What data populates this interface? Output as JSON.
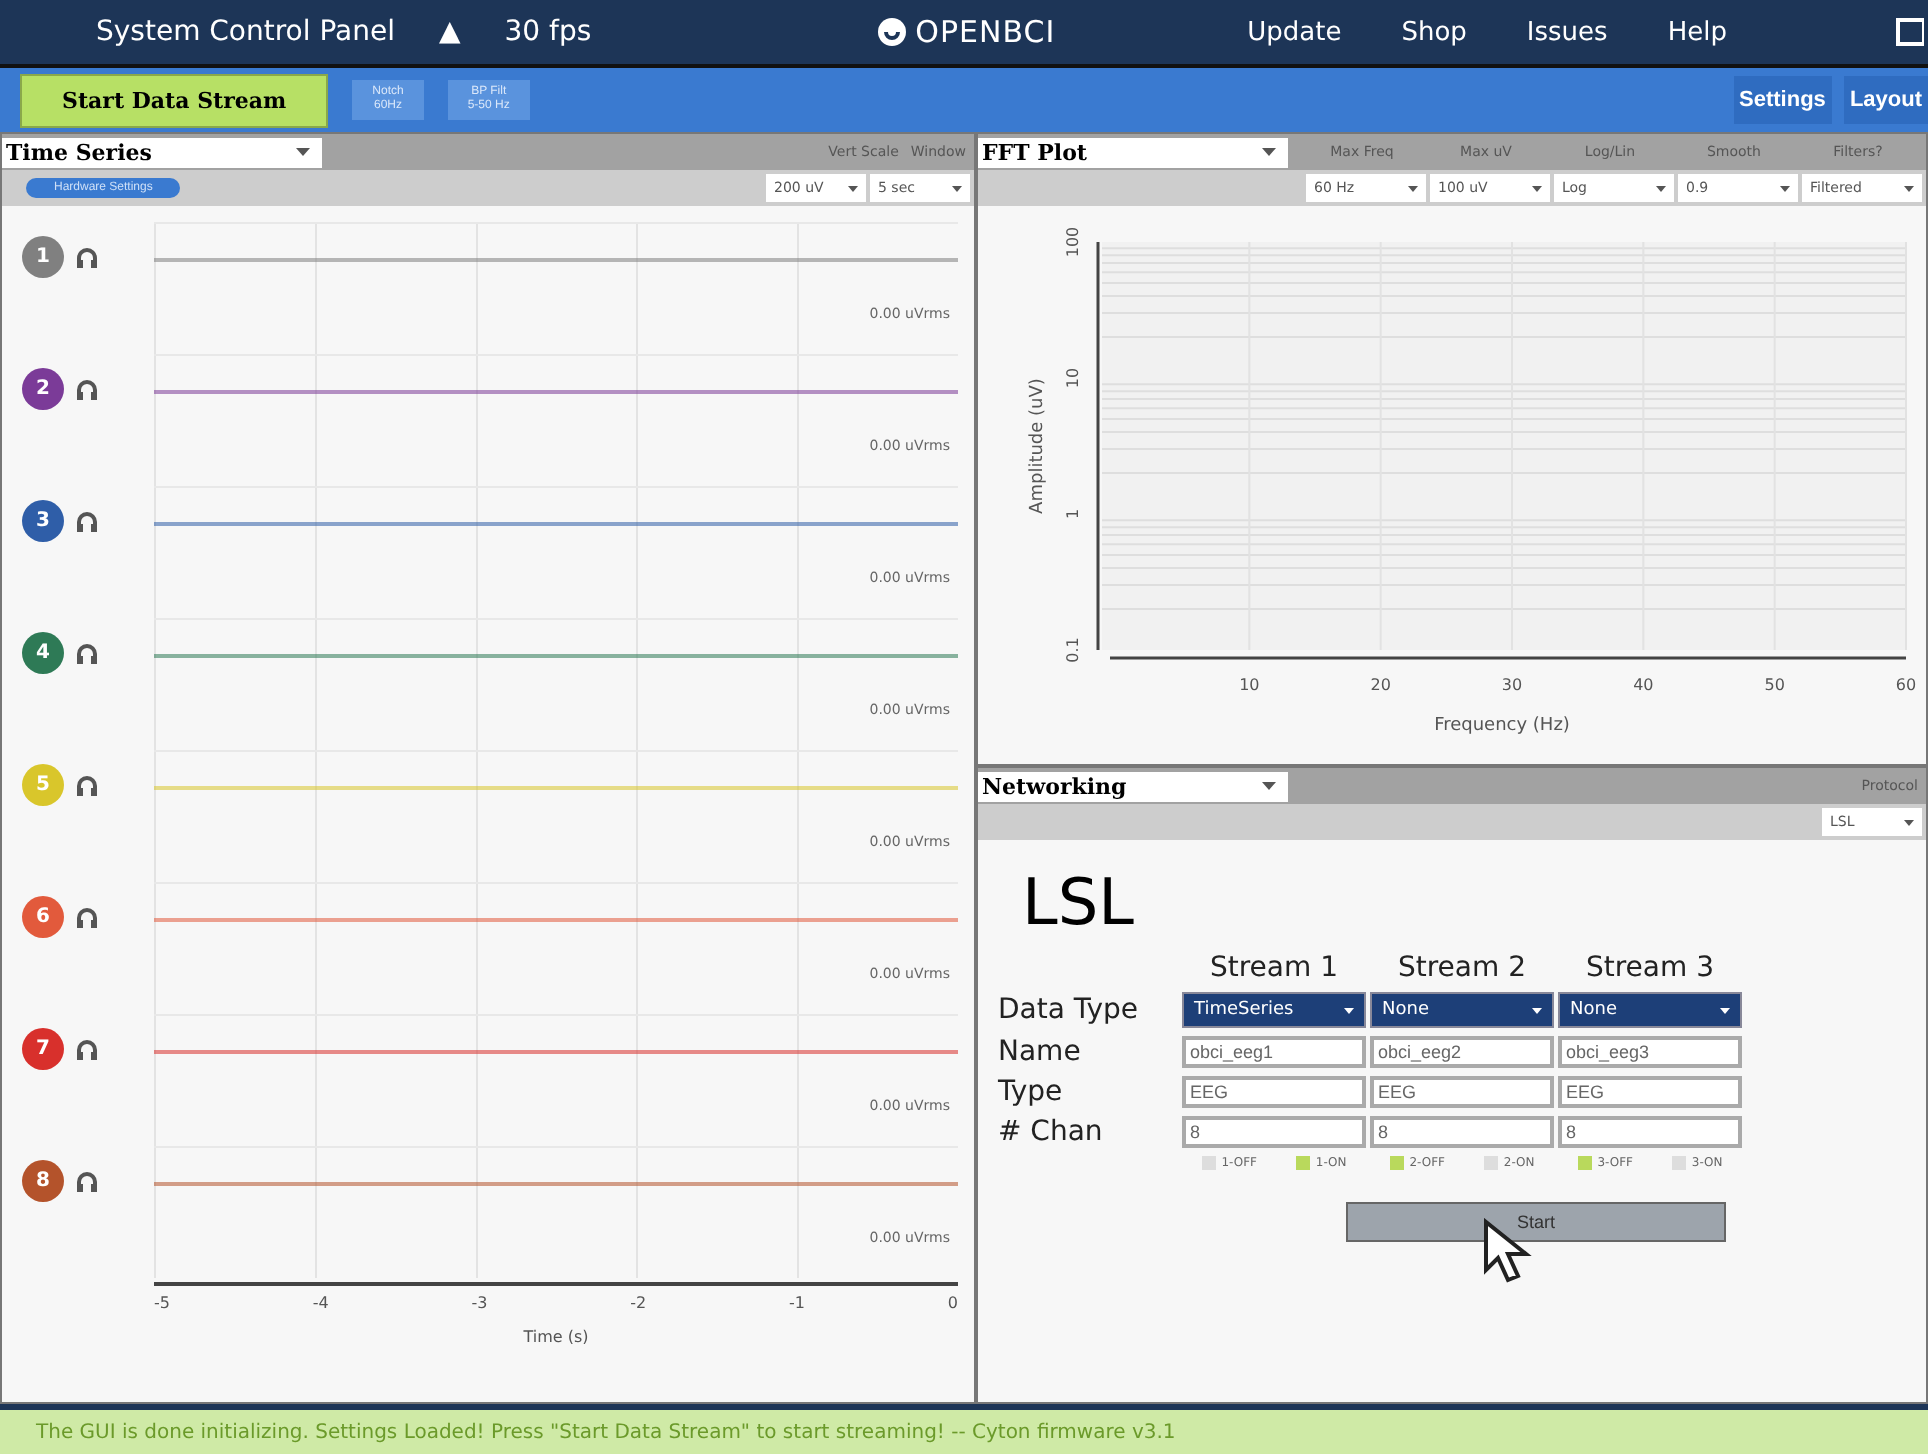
{
  "top_bar": {
    "title": "System Control Panel",
    "collapse_glyph": "▲",
    "fps": "30 fps",
    "logo": "OPENBCI",
    "menu": [
      "Update",
      "Shop",
      "Issues",
      "Help"
    ]
  },
  "toolbar": {
    "start_button": "Start Data Stream",
    "filters": [
      {
        "line1": "Notch",
        "line2": "60Hz"
      },
      {
        "line1": "BP Filt",
        "line2": "5-50 Hz"
      }
    ],
    "right_buttons": [
      "Settings",
      "Layout"
    ]
  },
  "time_series": {
    "widget": "Time Series",
    "hardware_button": "Hardware Settings",
    "controls": [
      {
        "label": "Vert Scale",
        "value": "200 uV"
      },
      {
        "label": "Window",
        "value": "5 sec"
      }
    ],
    "channels": [
      {
        "number": "1",
        "color": "#808080",
        "reading": "0.00 uVrms"
      },
      {
        "number": "2",
        "color": "#7b3b98",
        "reading": "0.00 uVrms"
      },
      {
        "number": "3",
        "color": "#2f5ea8",
        "reading": "0.00 uVrms"
      },
      {
        "number": "4",
        "color": "#2e7a56",
        "reading": "0.00 uVrms"
      },
      {
        "number": "5",
        "color": "#d9c62b",
        "reading": "0.00 uVrms"
      },
      {
        "number": "6",
        "color": "#e25a3c",
        "reading": "0.00 uVrms"
      },
      {
        "number": "7",
        "color": "#d8302c",
        "reading": "0.00 uVrms"
      },
      {
        "number": "8",
        "color": "#b4532b",
        "reading": "0.00 uVrms"
      }
    ],
    "x_ticks": [
      "-5",
      "-4",
      "-3",
      "-2",
      "-1",
      "0"
    ],
    "x_label": "Time (s)"
  },
  "fft": {
    "widget": "FFT Plot",
    "controls": [
      {
        "label": "Max Freq",
        "value": "60 Hz"
      },
      {
        "label": "Max uV",
        "value": "100 uV"
      },
      {
        "label": "Log/Lin",
        "value": "Log"
      },
      {
        "label": "Smooth",
        "value": "0.9"
      },
      {
        "label": "Filters?",
        "value": "Filtered"
      }
    ],
    "y_ticks": [
      "100",
      "10",
      "1",
      "0.1"
    ],
    "x_ticks": [
      "10",
      "20",
      "30",
      "40",
      "50",
      "60"
    ],
    "x_label": "Frequency (Hz)",
    "y_label": "Amplitude (uV)"
  },
  "networking": {
    "widget": "Networking",
    "protocol_label": "Protocol",
    "protocol": "LSL",
    "heading": "LSL",
    "row_labels": [
      "Data Type",
      "Name",
      "Type",
      "# Chan"
    ],
    "streams": [
      {
        "title": "Stream 1",
        "data_type": "TimeSeries",
        "name": "obci_eeg1",
        "type": "EEG",
        "channels": "8",
        "options": [
          {
            "label": "1-OFF",
            "selected": false
          },
          {
            "label": "1-ON",
            "selected": true
          }
        ]
      },
      {
        "title": "Stream 2",
        "data_type": "None",
        "name": "obci_eeg2",
        "type": "EEG",
        "channels": "8",
        "options": [
          {
            "label": "2-OFF",
            "selected": true
          },
          {
            "label": "2-ON",
            "selected": false
          }
        ]
      },
      {
        "title": "Stream 3",
        "data_type": "None",
        "name": "obci_eeg3",
        "type": "EEG",
        "channels": "8",
        "options": [
          {
            "label": "3-OFF",
            "selected": true
          },
          {
            "label": "3-ON",
            "selected": false
          }
        ]
      }
    ],
    "start_button": "Start"
  },
  "status_bar": "The GUI is done initializing. Settings Loaded! Press \"Start Data Stream\" to start streaming! -- Cyton firmware v3.1"
}
